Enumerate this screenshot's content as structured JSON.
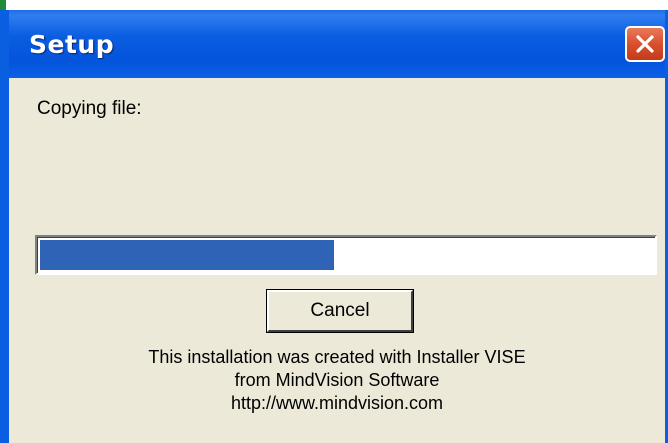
{
  "window": {
    "title": "Setup"
  },
  "dialog": {
    "status_label": "Copying file:",
    "progress": 0.48,
    "cancel_label": "Cancel",
    "footer_lines": [
      "This installation was created with Installer VISE",
      "from MindVision Software",
      "http://www.mindvision.com"
    ]
  },
  "colors": {
    "title_bar": "#0a5ce0",
    "progress_fill": "#2e63b5",
    "close_button": "#d9502e",
    "dialog_bg": "#ece9d8"
  },
  "icons": {
    "close": "close-icon"
  }
}
